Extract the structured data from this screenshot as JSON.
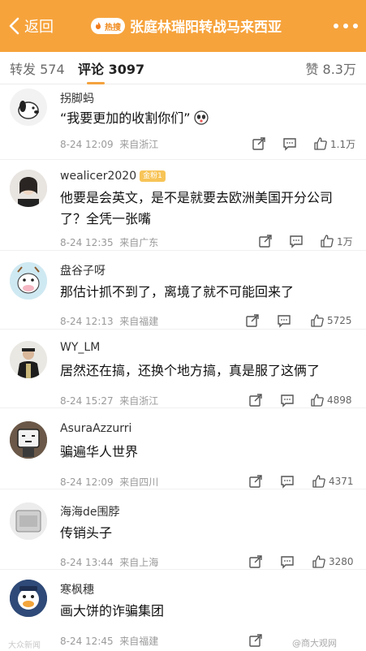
{
  "header": {
    "back_label": "返回",
    "hot_badge": "热搜",
    "title": "张庭林瑞阳转战马来西亚"
  },
  "tabs": {
    "repost": "转发 574",
    "comments": "评论 3097",
    "likes": "赞 8.3万"
  },
  "comments": [
    {
      "user": "拐脚蚂",
      "text": "“我要更加的收割你们”",
      "time": "8-24 12:09",
      "source": "来自浙江",
      "likes": "1.1万",
      "badge": ""
    },
    {
      "user": "wealicer2020",
      "text": "他要是会英文，是不是就要去欧洲美国开分公司了？全凭一张嘴",
      "time": "8-24 12:35",
      "source": "来自广东",
      "likes": "1万",
      "badge": "金粉1"
    },
    {
      "user": "盘谷子呀",
      "text": "那估计抓不到了，离境了就不可能回来了",
      "time": "8-24 12:13",
      "source": "来自福建",
      "likes": "5725",
      "badge": ""
    },
    {
      "user": "WY_LM",
      "text": "居然还在搞，还换个地方搞，真是服了这俩了",
      "time": "8-24 15:27",
      "source": "来自浙江",
      "likes": "4898",
      "badge": ""
    },
    {
      "user": "AsuraAzzurri",
      "text": "骗遍华人世界",
      "time": "8-24 12:09",
      "source": "来自四川",
      "likes": "4371",
      "badge": ""
    },
    {
      "user": "海海de围脖",
      "text": "传销头子",
      "time": "8-24 13:44",
      "source": "来自上海",
      "likes": "3280",
      "badge": ""
    },
    {
      "user": "寒枫穗",
      "text": "画大饼的诈骗集团",
      "time": "8-24 12:45",
      "source": "来自福建",
      "likes": "",
      "badge": ""
    }
  ],
  "watermarks": {
    "bottom_left": "大众新闻",
    "bottom_right": "@商大观网"
  },
  "colors": {
    "header_bg": "#f6a33c",
    "tab_accent": "#f4a33e"
  }
}
